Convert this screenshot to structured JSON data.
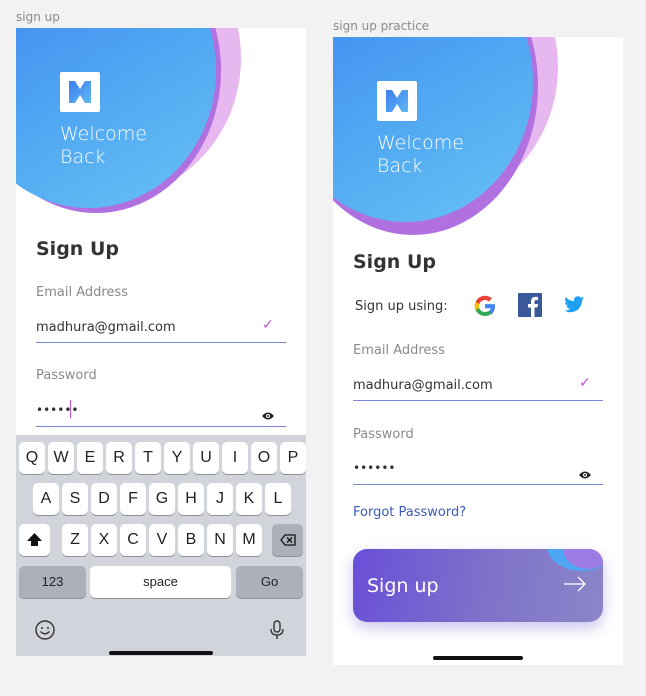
{
  "left": {
    "frame_label": "sign up",
    "welcome_line1": "Welcome",
    "welcome_line2": "Back",
    "heading": "Sign Up",
    "email_label": "Email Address",
    "email_value": "madhura@gmail.com",
    "password_label": "Password",
    "password_value": "••••••",
    "keyboard": {
      "row1": [
        "Q",
        "W",
        "E",
        "R",
        "T",
        "Y",
        "U",
        "I",
        "O",
        "P"
      ],
      "row2": [
        "A",
        "S",
        "D",
        "F",
        "G",
        "H",
        "J",
        "K",
        "L"
      ],
      "row3": [
        "Z",
        "X",
        "C",
        "V",
        "B",
        "N",
        "M"
      ],
      "numbers_key": "123",
      "space_key": "space",
      "go_key": "Go"
    }
  },
  "right": {
    "frame_label": "sign up practice",
    "welcome_line1": "Welcome",
    "welcome_line2": "Back",
    "heading": "Sign Up",
    "social_label": "Sign up using:",
    "email_label": "Email Address",
    "email_value": "madhura@gmail.com",
    "password_label": "Password",
    "password_value": "••••••",
    "forgot_link": "Forgot Password?",
    "signup_button": "Sign up"
  },
  "colors": {
    "accent_purple": "#c34fd6",
    "blob_blue": "#4a8ff0",
    "link_blue": "#3a5bb8"
  }
}
